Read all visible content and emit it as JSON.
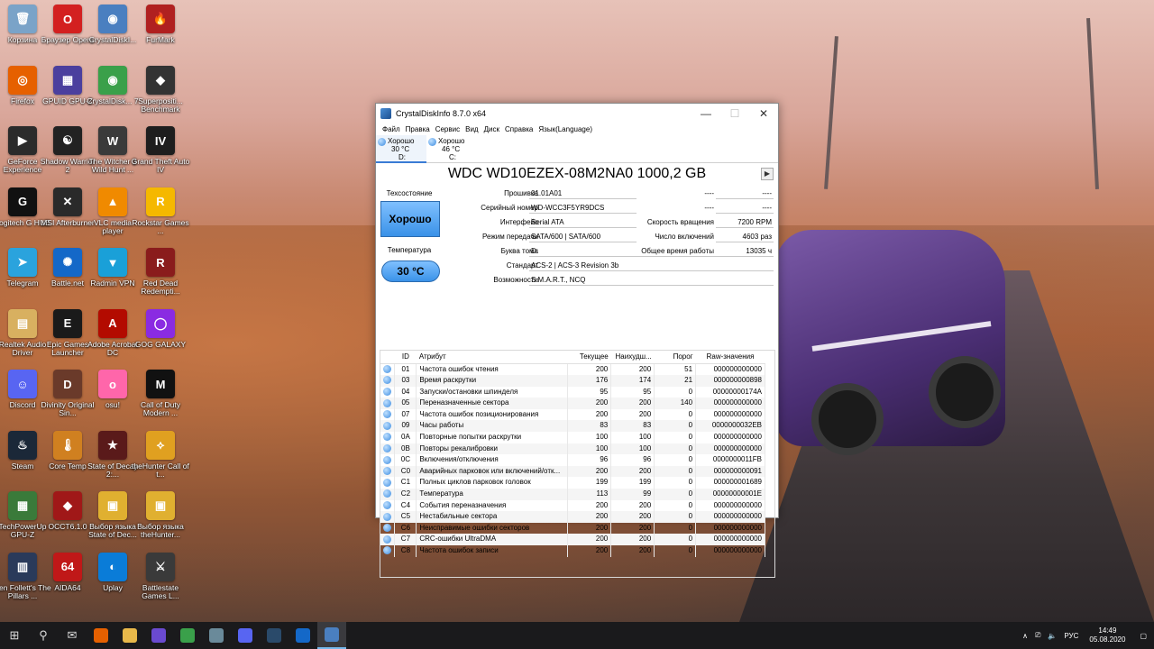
{
  "window": {
    "title": "CrystalDiskInfo 8.7.0 x64",
    "menu": [
      "Файл",
      "Правка",
      "Сервис",
      "Вид",
      "Диск",
      "Справка",
      "Язык(Language)"
    ],
    "drives": [
      {
        "status": "Хорошо",
        "temp": "30 °C",
        "letter": "D:",
        "active": true
      },
      {
        "status": "Хорошо",
        "temp": "46 °C",
        "letter": "C:",
        "active": false
      }
    ],
    "disk_title": "WDC WD10EZEX-08M2NA0 1000,2 GB",
    "health_label": "Техсостояние",
    "health_value": "Хорошо",
    "temp_label": "Температура",
    "temp_value": "30 °C",
    "fields": {
      "firmware": {
        "label": "Прошивка",
        "value": "01.01A01"
      },
      "serial": {
        "label": "Серийный номер",
        "value": "WD-WCC3F5YR9DCS"
      },
      "interface": {
        "label": "Интерфейс",
        "value": "Serial ATA"
      },
      "transfer": {
        "label": "Режим передачи",
        "value": "SATA/600 | SATA/600"
      },
      "letter": {
        "label": "Буква тома",
        "value": "D:"
      },
      "standard": {
        "label": "Стандарт",
        "value": "ACS-2 | ACS-3 Revision 3b"
      },
      "features": {
        "label": "Возможности",
        "value": "S.M.A.R.T., NCQ"
      },
      "blank1": {
        "label": "----",
        "value": "----"
      },
      "blank2": {
        "label": "----",
        "value": "----"
      },
      "rotation": {
        "label": "Скорость вращения",
        "value": "7200 RPM"
      },
      "power_count": {
        "label": "Число включений",
        "value": "4603 раз"
      },
      "power_hours": {
        "label": "Общее время работы",
        "value": "13035 ч"
      }
    },
    "smart_headers": [
      "ID",
      "Атрибут",
      "Текущее",
      "Наихудш...",
      "Порог",
      "Raw-значения"
    ],
    "smart_rows": [
      {
        "id": "01",
        "name": "Частота ошибок чтения",
        "cur": "200",
        "worst": "200",
        "thr": "51",
        "raw": "000000000000"
      },
      {
        "id": "03",
        "name": "Время раскрутки",
        "cur": "176",
        "worst": "174",
        "thr": "21",
        "raw": "000000000898"
      },
      {
        "id": "04",
        "name": "Запуски/остановки шпинделя",
        "cur": "95",
        "worst": "95",
        "thr": "0",
        "raw": "00000000174A"
      },
      {
        "id": "05",
        "name": "Переназначенные сектора",
        "cur": "200",
        "worst": "200",
        "thr": "140",
        "raw": "000000000000"
      },
      {
        "id": "07",
        "name": "Частота ошибок позиционирования",
        "cur": "200",
        "worst": "200",
        "thr": "0",
        "raw": "000000000000"
      },
      {
        "id": "09",
        "name": "Часы работы",
        "cur": "83",
        "worst": "83",
        "thr": "0",
        "raw": "0000000032EB"
      },
      {
        "id": "0A",
        "name": "Повторные попытки раскрутки",
        "cur": "100",
        "worst": "100",
        "thr": "0",
        "raw": "000000000000"
      },
      {
        "id": "0B",
        "name": "Повторы рекалибровки",
        "cur": "100",
        "worst": "100",
        "thr": "0",
        "raw": "000000000000"
      },
      {
        "id": "0C",
        "name": "Включения/отключения",
        "cur": "96",
        "worst": "96",
        "thr": "0",
        "raw": "0000000011FB"
      },
      {
        "id": "C0",
        "name": "Аварийных парковок или включений/отк...",
        "cur": "200",
        "worst": "200",
        "thr": "0",
        "raw": "000000000091"
      },
      {
        "id": "C1",
        "name": "Полных циклов парковок головок",
        "cur": "199",
        "worst": "199",
        "thr": "0",
        "raw": "000000001689"
      },
      {
        "id": "C2",
        "name": "Температура",
        "cur": "113",
        "worst": "99",
        "thr": "0",
        "raw": "00000000001E"
      },
      {
        "id": "C4",
        "name": "События переназначения",
        "cur": "200",
        "worst": "200",
        "thr": "0",
        "raw": "000000000000"
      },
      {
        "id": "C5",
        "name": "Нестабильные сектора",
        "cur": "200",
        "worst": "200",
        "thr": "0",
        "raw": "000000000000"
      },
      {
        "id": "C6",
        "name": "Неисправимые ошибки секторов",
        "cur": "200",
        "worst": "200",
        "thr": "0",
        "raw": "000000000000"
      },
      {
        "id": "C7",
        "name": "CRC-ошибки UltraDMA",
        "cur": "200",
        "worst": "200",
        "thr": "0",
        "raw": "000000000000"
      },
      {
        "id": "C8",
        "name": "Частота ошибок записи",
        "cur": "200",
        "worst": "200",
        "thr": "0",
        "raw": "000000000000"
      }
    ]
  },
  "desktop_icons": [
    {
      "label": "Корзина",
      "icon": "recycle-bin-icon",
      "color": "#7aa3c8",
      "glyph": "🗑"
    },
    {
      "label": "Браузер Opera",
      "icon": "opera-icon",
      "color": "#d32020",
      "glyph": "O"
    },
    {
      "label": "CrystalDiskI...",
      "icon": "crystaldiskinfo-icon",
      "color": "#4a7fc0",
      "glyph": "◉"
    },
    {
      "label": "FurMark",
      "icon": "furmark-icon",
      "color": "#b02020",
      "glyph": "🔥"
    },
    {
      "label": "Firefox",
      "icon": "firefox-icon",
      "color": "#e66000",
      "glyph": "◎"
    },
    {
      "label": "GPUID GPU-Z",
      "icon": "gpuz-icon",
      "color": "#4b3f9e",
      "glyph": "▦"
    },
    {
      "label": "CrystalDisk... 7",
      "icon": "crystaldiskmark-icon",
      "color": "#3aa04a",
      "glyph": "◉"
    },
    {
      "label": "Superpositi... Benchmark",
      "icon": "superposition-icon",
      "color": "#333",
      "glyph": "◆"
    },
    {
      "label": "GeForce Experience",
      "icon": "geforce-icon",
      "color": "#2b2b2b",
      "glyph": "▶"
    },
    {
      "label": "Shadow Warrior 2",
      "icon": "shadow-warrior-icon",
      "color": "#222",
      "glyph": "☯"
    },
    {
      "label": "The Witcher 3 Wild Hunt ...",
      "icon": "witcher-icon",
      "color": "#3a3a3a",
      "glyph": "W"
    },
    {
      "label": "Grand Theft Auto IV",
      "icon": "gta-icon",
      "color": "#1e1e1e",
      "glyph": "IV"
    },
    {
      "label": "Logitech G HUB",
      "icon": "logitech-icon",
      "color": "#111",
      "glyph": "G"
    },
    {
      "label": "MSI Afterburner",
      "icon": "msi-icon",
      "color": "#2a2a2a",
      "glyph": "✕"
    },
    {
      "label": "VLC media player",
      "icon": "vlc-icon",
      "color": "#f08a00",
      "glyph": "▲"
    },
    {
      "label": "Rockstar Games ...",
      "icon": "rockstar-icon",
      "color": "#f5b800",
      "glyph": "R"
    },
    {
      "label": "Telegram",
      "icon": "telegram-icon",
      "color": "#2aa3dd",
      "glyph": "➤"
    },
    {
      "label": "Battle.net",
      "icon": "battlenet-icon",
      "color": "#1468c8",
      "glyph": "✺"
    },
    {
      "label": "Radmin VPN",
      "icon": "radmin-icon",
      "color": "#1aa0d8",
      "glyph": "▼"
    },
    {
      "label": "Red Dead Redempti...",
      "icon": "rdr-icon",
      "color": "#8a1c1c",
      "glyph": "R"
    },
    {
      "label": "Realtek Audio Driver",
      "icon": "realtek-icon",
      "color": "#d8b060",
      "glyph": "▤"
    },
    {
      "label": "Epic Games Launcher",
      "icon": "epic-icon",
      "color": "#1a1a1a",
      "glyph": "E"
    },
    {
      "label": "Adobe Acrobat DC",
      "icon": "acrobat-icon",
      "color": "#b30b00",
      "glyph": "A"
    },
    {
      "label": "GOG GALAXY",
      "icon": "gog-icon",
      "color": "#8a2be2",
      "glyph": "◯"
    },
    {
      "label": "Discord",
      "icon": "discord-icon",
      "color": "#5865f2",
      "glyph": "☺"
    },
    {
      "label": "Divinity Original Sin...",
      "icon": "divinity-icon",
      "color": "#6a3a2a",
      "glyph": "D"
    },
    {
      "label": "osu!",
      "icon": "osu-icon",
      "color": "#ff66aa",
      "glyph": "o"
    },
    {
      "label": "Call of Duty Modern ...",
      "icon": "cod-icon",
      "color": "#111",
      "glyph": "M"
    },
    {
      "label": "Steam",
      "icon": "steam-icon",
      "color": "#1b2838",
      "glyph": "♨"
    },
    {
      "label": "Core Temp",
      "icon": "coretemp-icon",
      "color": "#d08020",
      "glyph": "🌡"
    },
    {
      "label": "State of Decay 2:...",
      "icon": "sod2-icon",
      "color": "#5a1a1a",
      "glyph": "★"
    },
    {
      "label": "theHunter Call of t...",
      "icon": "thehunter-icon",
      "color": "#e0a020",
      "glyph": "⟡"
    },
    {
      "label": "TechPowerUp GPU-Z",
      "icon": "techpowerup-icon",
      "color": "#3a7a3a",
      "glyph": "▦"
    },
    {
      "label": "OCCT6.1.0",
      "icon": "occt-icon",
      "color": "#a01818",
      "glyph": "◆"
    },
    {
      "label": "Выбор языка State of Dec...",
      "icon": "sod-lang-icon",
      "color": "#e0b030",
      "glyph": "▣"
    },
    {
      "label": "Выбор языка theHunter...",
      "icon": "hunter-lang-icon",
      "color": "#e0b030",
      "glyph": "▣"
    },
    {
      "label": "Ken Follett's The Pillars ...",
      "icon": "pillars-icon",
      "color": "#2a3a5a",
      "glyph": "▥"
    },
    {
      "label": "AIDA64",
      "icon": "aida64-icon",
      "color": "#c01818",
      "glyph": "64"
    },
    {
      "label": "Uplay",
      "icon": "uplay-icon",
      "color": "#0a7cd8",
      "glyph": "◐"
    },
    {
      "label": "Battlestate Games L...",
      "icon": "battlestate-icon",
      "color": "#3a3a3a",
      "glyph": "⚔"
    }
  ],
  "taskbar": {
    "items": [
      {
        "icon": "start-icon",
        "glyph": "⊞",
        "color": ""
      },
      {
        "icon": "search-icon",
        "glyph": "⚲",
        "color": ""
      },
      {
        "icon": "mail-icon",
        "glyph": "✉",
        "color": ""
      },
      {
        "icon": "firefox-icon",
        "glyph": "",
        "color": "#e66000"
      },
      {
        "icon": "folder-icon",
        "glyph": "",
        "color": "#e8b84a"
      },
      {
        "icon": "gpuz-icon",
        "glyph": "",
        "color": "#6a4ad0"
      },
      {
        "icon": "msi-afterburner-icon",
        "glyph": "",
        "color": "#3aa04a"
      },
      {
        "icon": "crystaldiskmark-icon",
        "glyph": "",
        "color": "#6a8a9a"
      },
      {
        "icon": "discord-icon",
        "glyph": "",
        "color": "#5865f2"
      },
      {
        "icon": "steam-icon",
        "glyph": "",
        "color": "#2a4a6a"
      },
      {
        "icon": "battlenet-icon",
        "glyph": "",
        "color": "#1468c8"
      },
      {
        "icon": "crystaldiskinfo-icon",
        "glyph": "",
        "color": "#4a7fc0",
        "active": true
      }
    ],
    "lang": "РУС",
    "time": "14:49",
    "date": "05.08.2020"
  }
}
